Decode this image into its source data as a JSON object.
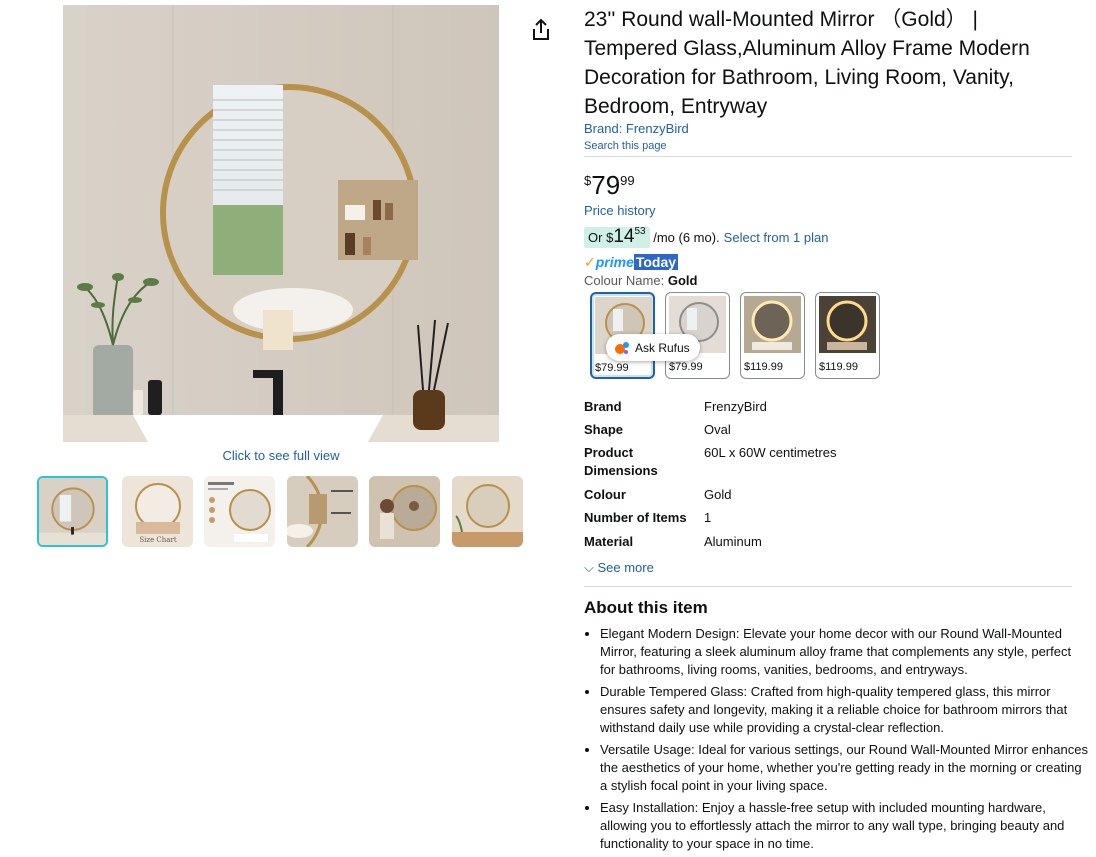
{
  "product": {
    "title": "23'' Round wall-Mounted Mirror （Gold） | Tempered Glass,Aluminum Alloy Frame Modern Decoration for Bathroom, Living Room, Vanity, Bedroom, Entryway",
    "brand_link": "Brand: FrenzyBird",
    "search_page": "Search this page"
  },
  "gallery": {
    "full_view": "Click to see full view",
    "thumb_caption_2": "Size Chart"
  },
  "price": {
    "symbol": "$",
    "whole": "79",
    "fraction": "99",
    "history": "Price history"
  },
  "installment": {
    "prefix": "Or",
    "symbol": "$",
    "whole": "14",
    "fraction": "53",
    "suffix": "/mo (6 mo).",
    "plan": "Select from 1 plan"
  },
  "prime": {
    "check": "✓",
    "word": "prime",
    "today": "Today"
  },
  "colour": {
    "label": "Colour Name:",
    "value": "Gold"
  },
  "swatches": [
    {
      "price": "$79.99"
    },
    {
      "price": "$79.99"
    },
    {
      "price": "$119.99"
    },
    {
      "price": "$119.99"
    }
  ],
  "rufus": {
    "label": "Ask Rufus"
  },
  "specs": [
    {
      "key": "Brand",
      "value": "FrenzyBird"
    },
    {
      "key": "Shape",
      "value": "Oval"
    },
    {
      "key": "Product Dimensions",
      "value": "60L x 60W centimetres"
    },
    {
      "key": "Colour",
      "value": "Gold"
    },
    {
      "key": "Number of Items",
      "value": "1"
    },
    {
      "key": "Material",
      "value": "Aluminum"
    }
  ],
  "see_more": "See more",
  "about": {
    "heading": "About this item",
    "bullets": [
      "Elegant Modern Design: Elevate your home decor with our Round Wall-Mounted Mirror, featuring a sleek aluminum alloy frame that complements any style, perfect for bathrooms, living rooms, vanities, bedrooms, and entryways.",
      "Durable Tempered Glass: Crafted from high-quality tempered glass, this mirror ensures safety and longevity, making it a reliable choice for bathroom mirrors that withstand daily use while providing a crystal-clear reflection.",
      "Versatile Usage: Ideal for various settings, our Round Wall-Mounted Mirror enhances the aesthetics of your home, whether you're getting ready in the morning or creating a stylish focal point in your living space.",
      "Easy Installation: Enjoy a hassle-free setup with included mounting hardware, allowing you to effortlessly attach the mirror to any wall type, bringing beauty and functionality to your space in no time."
    ]
  },
  "colors": {
    "link": "#2162a1",
    "prime": "#1a98ff",
    "selected_border": "#2162a1",
    "thumb_active": "#2ac5d4"
  },
  "icons": {
    "share": "share-icon",
    "chevron": "chevron-down-icon"
  }
}
